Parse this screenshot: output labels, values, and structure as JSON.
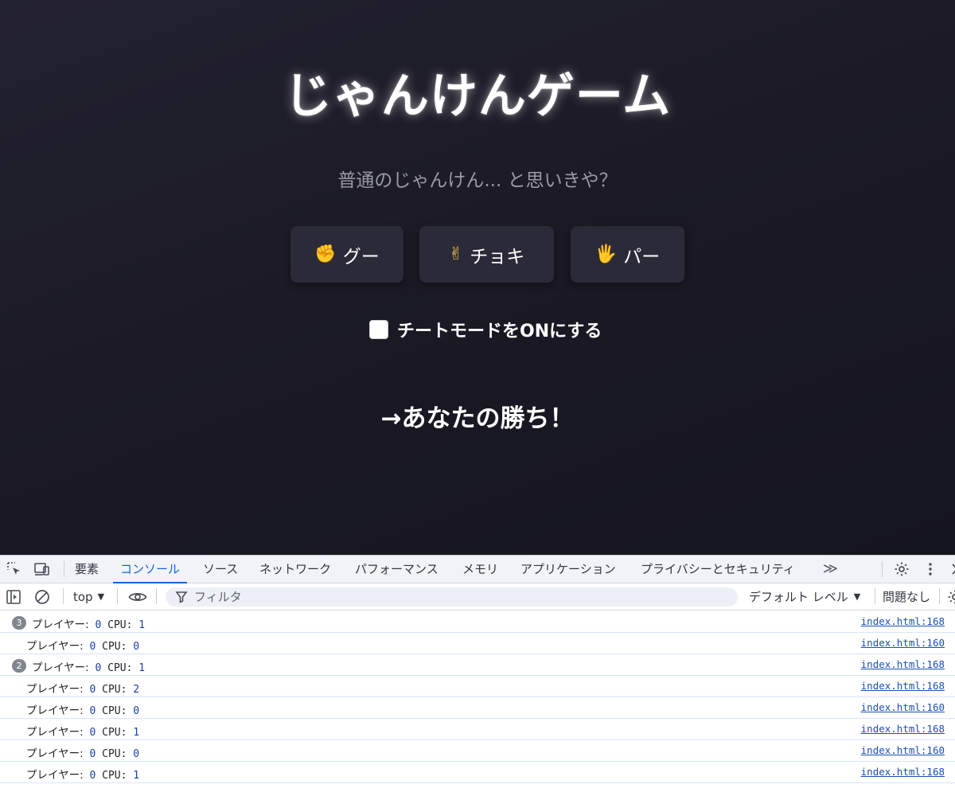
{
  "game": {
    "title": "じゃんけんゲーム",
    "subtitle": "普通のじゃんけん... と思いきや？",
    "choices": [
      {
        "emoji": "✊",
        "label": "グー"
      },
      {
        "emoji": "✌",
        "label": "チョキ"
      },
      {
        "emoji": "🖐",
        "label": "パー"
      }
    ],
    "cheat_label": "チートモードをONにする",
    "cheat_checked": false,
    "result": "→あなたの勝ち！"
  },
  "devtools": {
    "tabs": [
      "要素",
      "コンソール",
      "ソース",
      "ネットワーク",
      "パフォーマンス",
      "メモリ",
      "アプリケーション",
      "プライバシーとセキュリティ"
    ],
    "active_tab": "コンソール",
    "context": "top",
    "filter_placeholder": "フィルタ",
    "level": "デフォルト レベル",
    "issues": "問題なし",
    "logs": [
      {
        "count": "3",
        "player_label": "プレイヤー:",
        "player": "0",
        "cpu_label": "CPU:",
        "cpu": "1",
        "source": "index.html:168"
      },
      {
        "count": "",
        "player_label": "プレイヤー:",
        "player": "0",
        "cpu_label": "CPU:",
        "cpu": "0",
        "source": "index.html:160"
      },
      {
        "count": "2",
        "player_label": "プレイヤー:",
        "player": "0",
        "cpu_label": "CPU:",
        "cpu": "1",
        "source": "index.html:168"
      },
      {
        "count": "",
        "player_label": "プレイヤー:",
        "player": "0",
        "cpu_label": "CPU:",
        "cpu": "2",
        "source": "index.html:168"
      },
      {
        "count": "",
        "player_label": "プレイヤー:",
        "player": "0",
        "cpu_label": "CPU:",
        "cpu": "0",
        "source": "index.html:160"
      },
      {
        "count": "",
        "player_label": "プレイヤー:",
        "player": "0",
        "cpu_label": "CPU:",
        "cpu": "1",
        "source": "index.html:168"
      },
      {
        "count": "",
        "player_label": "プレイヤー:",
        "player": "0",
        "cpu_label": "CPU:",
        "cpu": "0",
        "source": "index.html:160"
      },
      {
        "count": "",
        "player_label": "プレイヤー:",
        "player": "0",
        "cpu_label": "CPU:",
        "cpu": "1",
        "source": "index.html:168"
      }
    ]
  }
}
